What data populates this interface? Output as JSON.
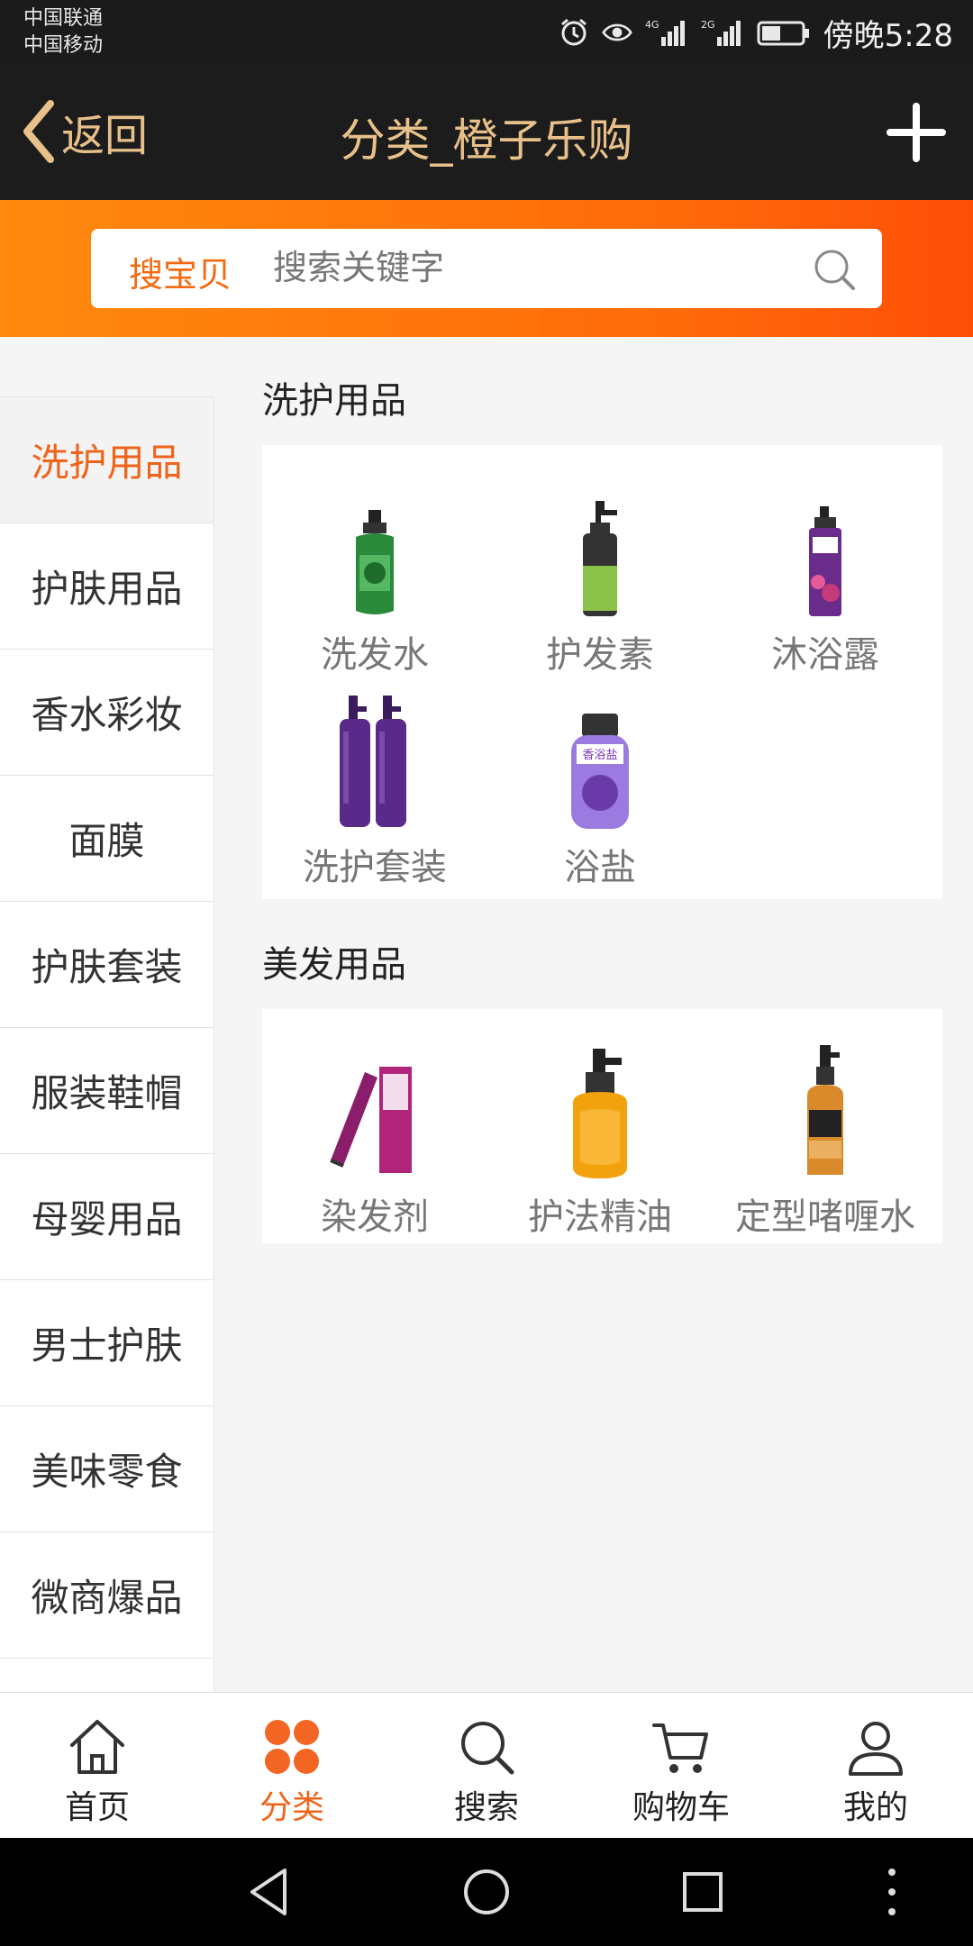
{
  "status_bar": {
    "carrier1": "中国联通",
    "carrier2": "中国移动",
    "network1": "4G",
    "network2": "2G",
    "time": "傍晚5:28"
  },
  "header": {
    "back_label": "返回",
    "title": "分类_橙子乐购"
  },
  "search": {
    "scope": "搜宝贝",
    "placeholder": "搜索关键字"
  },
  "sidebar": {
    "items": [
      {
        "label": "洗护用品",
        "active": true
      },
      {
        "label": "护肤用品"
      },
      {
        "label": "香水彩妆"
      },
      {
        "label": "面膜"
      },
      {
        "label": "护肤套装"
      },
      {
        "label": "服装鞋帽"
      },
      {
        "label": "母婴用品"
      },
      {
        "label": "男士护肤"
      },
      {
        "label": "美味零食"
      },
      {
        "label": "微商爆品"
      }
    ]
  },
  "sections": [
    {
      "title": "洗护用品",
      "items": [
        {
          "label": "洗发水",
          "icon": "green-shampoo-bottle-icon"
        },
        {
          "label": "护发素",
          "icon": "conditioner-bottle-icon"
        },
        {
          "label": "沐浴露",
          "icon": "body-wash-bottle-icon"
        },
        {
          "label": "洗护套装",
          "icon": "shampoo-set-icon"
        },
        {
          "label": "浴盐",
          "icon": "bath-salt-jar-icon",
          "jar_text": "香浴盐"
        }
      ]
    },
    {
      "title": "美发用品",
      "items": [
        {
          "label": "染发剂",
          "icon": "hair-dye-box-icon"
        },
        {
          "label": "护法精油",
          "icon": "hair-oil-bottle-icon"
        },
        {
          "label": "定型啫喱水",
          "icon": "styling-spray-bottle-icon"
        }
      ]
    }
  ],
  "tabbar": {
    "items": [
      {
        "label": "首页",
        "icon": "home-icon"
      },
      {
        "label": "分类",
        "icon": "category-grid-icon",
        "active": true
      },
      {
        "label": "搜索",
        "icon": "search-icon"
      },
      {
        "label": "购物车",
        "icon": "cart-icon"
      },
      {
        "label": "我的",
        "icon": "user-icon"
      }
    ]
  },
  "colors": {
    "accent": "#f0631a",
    "header_bg": "#1c1c1c",
    "header_text": "#e7c08a",
    "search_band": "#ff7a0c"
  }
}
